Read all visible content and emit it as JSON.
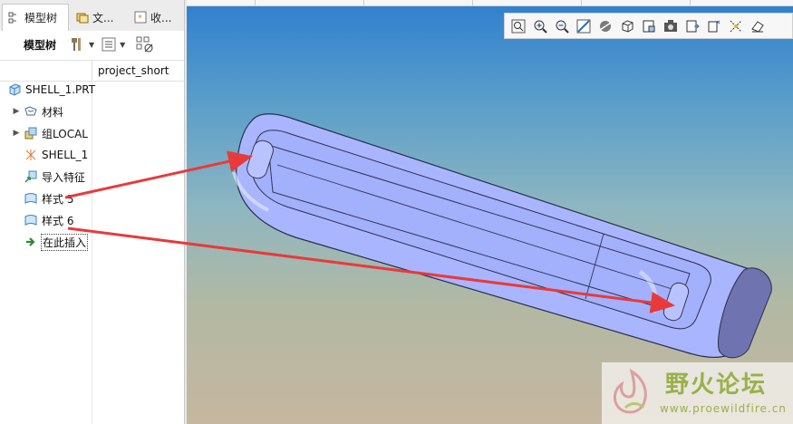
{
  "tabs": [
    {
      "label": "模型树",
      "icon": "model-tree-icon"
    },
    {
      "label": "文...",
      "icon": "folder-browser-icon"
    },
    {
      "label": "收...",
      "icon": "favorites-icon"
    }
  ],
  "toolbar": {
    "label": "模型树",
    "icons": [
      "tree-settings-icon",
      "dropdown-arrow-icon",
      "show-icon",
      "dropdown-arrow-icon",
      "filter-icon"
    ]
  },
  "columns": {
    "col2": "project_short"
  },
  "tree": [
    {
      "label": "SHELL_1.PRT",
      "icon": "part-icon",
      "expander": ""
    },
    {
      "label": "材料",
      "icon": "material-icon",
      "expander": "▶"
    },
    {
      "label": "组LOCAL",
      "icon": "group-icon",
      "expander": "▶"
    },
    {
      "label": "SHELL_1",
      "icon": "coordinate-system-icon",
      "expander": ""
    },
    {
      "label": "导入特征",
      "icon": "import-feature-icon",
      "expander": ""
    },
    {
      "label": "样式 5",
      "icon": "style-surface-icon",
      "expander": ""
    },
    {
      "label": "样式 6",
      "icon": "style-surface-icon",
      "expander": ""
    },
    {
      "label": "在此插入",
      "icon": "insert-here-arrow-icon",
      "expander": ""
    }
  ],
  "view_toolbar": [
    "refit-icon",
    "zoom-in-icon",
    "zoom-out-icon",
    "repaint-icon",
    "display-style-icon",
    "saved-orientations-icon",
    "view-manager-icon",
    "perspective-view-icon",
    "section-icon",
    "datum-display-icon",
    "annotation-display-icon",
    "spin-center-icon"
  ],
  "watermark": {
    "title": "野火论坛",
    "url": "www.proewildfire.cn"
  },
  "colors": {
    "arrow": "#e83a3a",
    "model": "#a9b6ff",
    "accent": "#2d7bc8"
  }
}
